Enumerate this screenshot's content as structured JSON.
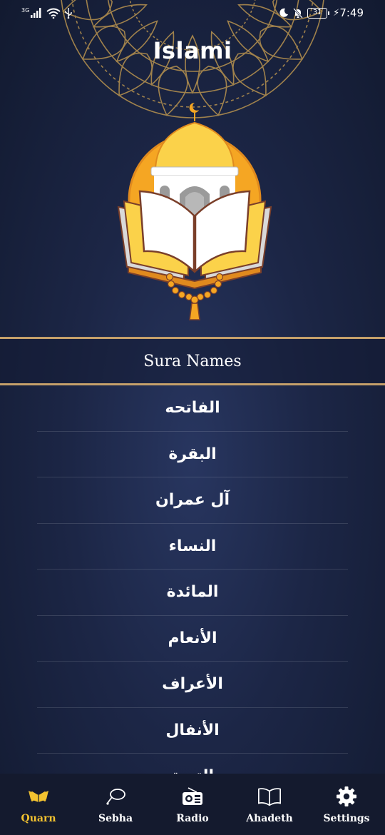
{
  "status_bar": {
    "network": "3G",
    "battery": "31",
    "time": "7:49"
  },
  "app": {
    "title": "Islami"
  },
  "section": {
    "title": "Sura Names"
  },
  "sura_list": [
    "الفاتحه",
    "البقرة",
    "آل عمران",
    "النساء",
    "المائدة",
    "الأنعام",
    "الأعراف",
    "الأنفال",
    "التوبة"
  ],
  "bottom_nav": [
    {
      "label": "Quarn",
      "icon": "quran-icon",
      "active": true
    },
    {
      "label": "Sebha",
      "icon": "sebha-icon",
      "active": false
    },
    {
      "label": "Radio",
      "icon": "radio-icon",
      "active": false
    },
    {
      "label": "Ahadeth",
      "icon": "book-icon",
      "active": false
    },
    {
      "label": "Settings",
      "icon": "gear-icon",
      "active": false
    }
  ],
  "colors": {
    "accent": "#f2c230",
    "divider_gold": "#c5a06a",
    "nav_background": "#141a2e",
    "background": "#1c2646"
  }
}
